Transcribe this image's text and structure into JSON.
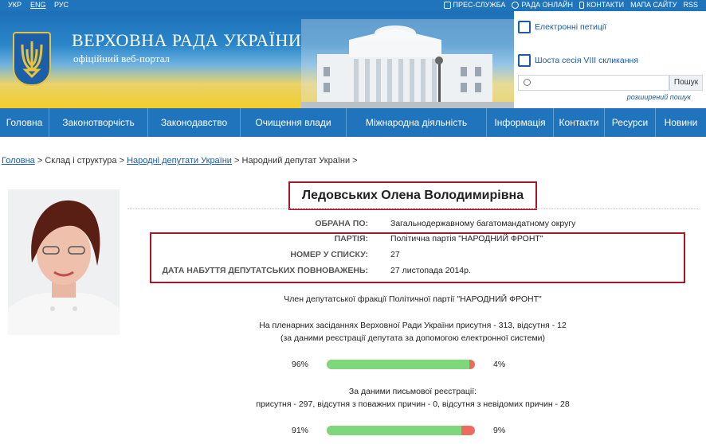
{
  "topbar": {
    "languages": [
      "УКР",
      "ENG",
      "РУС"
    ],
    "links": [
      "ПРЕС-СЛУЖБА",
      "РАДА ОНЛАЙН",
      "КОНТАКТИ",
      "МАПА САЙТУ",
      "RSS"
    ]
  },
  "header": {
    "title": "ВЕРХОВНА РАДА УКРАЇНИ",
    "subtitle": "офіційний веб-портал",
    "petitions": "Електронні петиції",
    "session": "Шоста сесія VIII скликання",
    "search_placeholder": "",
    "search_button": "Пошук",
    "advanced_search": "розширений пошук"
  },
  "nav": [
    "Головна",
    "Законотворчість",
    "Законодавство",
    "Очищення влади",
    "Міжнародна діяльність",
    "Інформація",
    "Контакти",
    "Ресурси",
    "Новини"
  ],
  "breadcrumb": {
    "home": "Головна",
    "sep": ">",
    "section": "Склад і структура",
    "deputies": "Народні депутати України",
    "current": "Народний депутат України"
  },
  "deputy": {
    "name": "Ледовських Олена Володимирівна",
    "fields": [
      {
        "label": "ОБРАНА ПО:",
        "value": "Загальнодержавному багатомандатному округу"
      },
      {
        "label": "ПАРТІЯ:",
        "value": "Політична партія \"НАРОДНИЙ ФРОНТ\""
      },
      {
        "label": "НОМЕР У СПИСКУ:",
        "value": "27"
      },
      {
        "label": "ДАТА НАБУТТЯ ДЕПУТАТСЬКИХ ПОВНОВАЖЕНЬ:",
        "value": "27 листопада 2014р."
      }
    ],
    "faction": "Член депутатської фракції Політичної партії \"НАРОДНИЙ ФРОНТ\"",
    "attendance_1_line1": "На пленарних засіданнях Верховної Ради України присутня - 313, відсутня - 12",
    "attendance_1_line2": "(за даними реєстрації депутата за допомогою електронної системи)",
    "bar1": {
      "present_label": "96%",
      "absent_label": "4%",
      "present_fraction": 0.96
    },
    "attendance_2_line1": "За даними письмової реєстрації:",
    "attendance_2_line2": "присутня - 297, відсутня з поважних причин - 0, відсутня з невідомих причин - 28",
    "bar2": {
      "present_label": "91%",
      "absent_label": "9%",
      "present_fraction": 0.91
    }
  },
  "colors": {
    "brand_blue": "#1f74bb",
    "highlight_red": "#a8162a",
    "present_green": "#7ed77a",
    "absent_red": "#ec6a5e"
  }
}
